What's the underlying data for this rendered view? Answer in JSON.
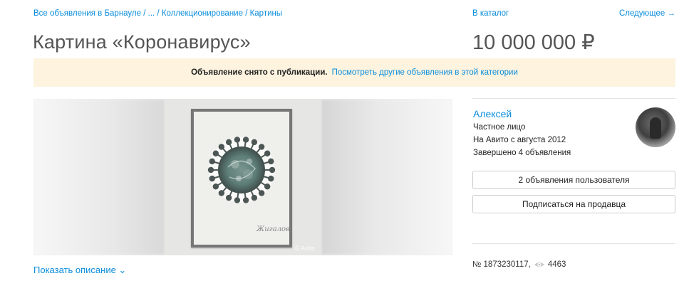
{
  "breadcrumb": "Все объявления в Барнауле / ... / Коллекционирование / Картины",
  "nav": {
    "catalog": "В каталог",
    "next": "Следующее →"
  },
  "listing": {
    "title": "Картина «Коронавирус»",
    "price": "10 000 000 ₽"
  },
  "notice": {
    "text": "Объявление снято с публикации.",
    "link": "Посмотреть другие объявления в этой категории"
  },
  "gallery": {
    "signature": "Жигалов",
    "watermark": "© Avito"
  },
  "description_toggle": "Показать описание ⌄",
  "seller": {
    "name": "Алексей",
    "type": "Частное лицо",
    "since": "На Авито с августа 2012",
    "completed": "Завершено 4 объявления"
  },
  "buttons": {
    "user_ads": "2 объявления пользователя",
    "subscribe": "Подписаться на продавца"
  },
  "meta": {
    "number": "№ 1873230117,",
    "views": "4463"
  },
  "colors": {
    "link": "#0a8ddb",
    "notice_bg": "#fdf3df",
    "virus": "#5e7f78"
  }
}
